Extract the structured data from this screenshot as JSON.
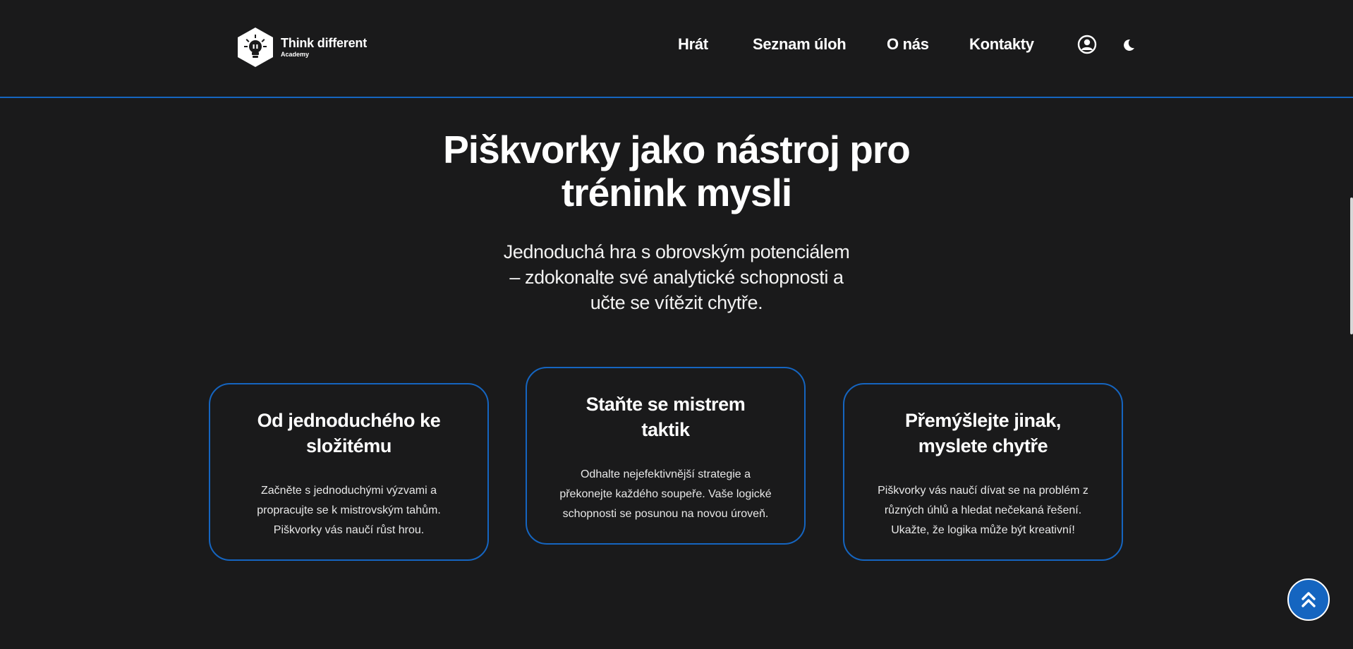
{
  "brand": {
    "name": "Think different",
    "sub": "Academy"
  },
  "nav": {
    "items": [
      {
        "label": "Hrát"
      },
      {
        "label": "Seznam úloh"
      },
      {
        "label": "O nás"
      },
      {
        "label": "Kontakty"
      }
    ],
    "icons": [
      "user-circle-icon",
      "moon-icon"
    ]
  },
  "hero": {
    "title_line1": "Piškvorky jako nástroj pro",
    "title_line2": "trénink mysli",
    "sub_line1": "Jednoduchá hra s obrovským potenciálem",
    "sub_line2": "– zdokonalte své analytické schopnosti a",
    "sub_line3": "učte se vítězit chytře."
  },
  "cards": [
    {
      "title_line1": "Od jednoduchého ke",
      "title_line2": "složitému",
      "text_line1": "Začněte s jednoduchými výzvami a",
      "text_line2": "propracujte se k mistrovským tahům.",
      "text_line3": "Piškvorky vás naučí růst hrou."
    },
    {
      "title_line1": "Staňte se mistrem",
      "title_line2": "taktik",
      "text_line1": "Odhalte nejefektivnější strategie a",
      "text_line2": "překonejte každého soupeře. Vaše logické",
      "text_line3": "schopnosti se posunou na novou úroveň."
    },
    {
      "title_line1": "Přemýšlejte jinak,",
      "title_line2": "myslete chytře",
      "text_line1": "Piškvorky vás naučí dívat se na problém z",
      "text_line2": "různých úhlů a hledat nečekaná řešení.",
      "text_line3": "Ukažte, že logika může být kreativní!"
    }
  ],
  "colors": {
    "background": "#1a1a1b",
    "accent": "#1565c0",
    "text": "#ffffff"
  },
  "back_to_top_icon": "double-chevron-up-icon"
}
